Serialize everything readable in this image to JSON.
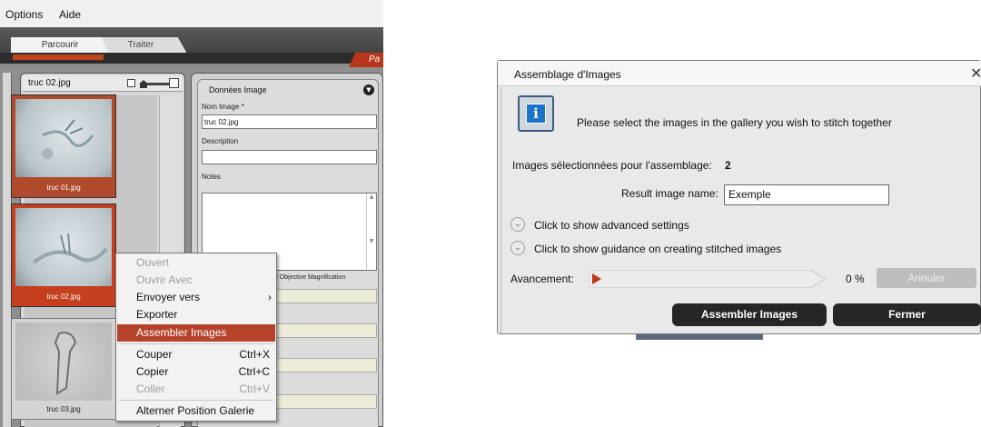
{
  "menubar": {
    "items": [
      "Options",
      "Aide"
    ]
  },
  "tabs": [
    "Parcourir",
    "Traiter"
  ],
  "side_tab": "Pa",
  "gallery": {
    "title": "truc 02.jpg",
    "thumbnails": [
      {
        "label": "truc 01.jpg"
      },
      {
        "label": "truc 02.jpg"
      },
      {
        "label": "truc 03.jpg"
      }
    ]
  },
  "image_data": {
    "title": "Données Image",
    "name_label": "Nom Image *",
    "name_value": "truc 02.jpg",
    "description_label": "Description",
    "description_value": "",
    "notes_label": "Notes",
    "magnification_label": "e Objective Magnification"
  },
  "context_menu": {
    "items": [
      {
        "label": "Ouvert",
        "shortcut": "",
        "disabled": true
      },
      {
        "label": "Ouvrir Avec",
        "shortcut": "",
        "disabled": true
      },
      {
        "label": "Envoyer vers",
        "shortcut": "",
        "disabled": false,
        "submenu": true
      },
      {
        "label": "Exporter",
        "shortcut": "",
        "disabled": false
      },
      {
        "label": "Assembler Images",
        "shortcut": "",
        "disabled": false,
        "active": true
      },
      {
        "label": "Couper",
        "shortcut": "Ctrl+X",
        "disabled": false
      },
      {
        "label": "Copier",
        "shortcut": "Ctrl+C",
        "disabled": false
      },
      {
        "label": "Coller",
        "shortcut": "Ctrl+V",
        "disabled": true
      },
      {
        "label": "Alterner Position Galerie",
        "shortcut": "",
        "disabled": false
      }
    ]
  },
  "dialog": {
    "title": "Assemblage d'Images",
    "close_symbol": "✕",
    "info_symbol": "i",
    "message": "Please select the images in the gallery you wish to stitch together",
    "selected_label": "Images sélectionnées pour l'assemblage:",
    "selected_count": "2",
    "result_label": "Result image name:",
    "result_value": "Exemple",
    "advanced_label": "Click to show advanced settings",
    "guidance_label": "Click to show guidance on creating stitched images",
    "progress_label": "Avancement:",
    "progress_percent": "0 %",
    "progress_value": 0,
    "cancel_label": "Annuler",
    "assemble_label": "Assembler Images",
    "close_label": "Fermer"
  },
  "colors": {
    "accent": "#c0461f",
    "menu_highlight": "#b5432a",
    "dark_button": "#262626",
    "info_blue": "#1d72c9"
  }
}
